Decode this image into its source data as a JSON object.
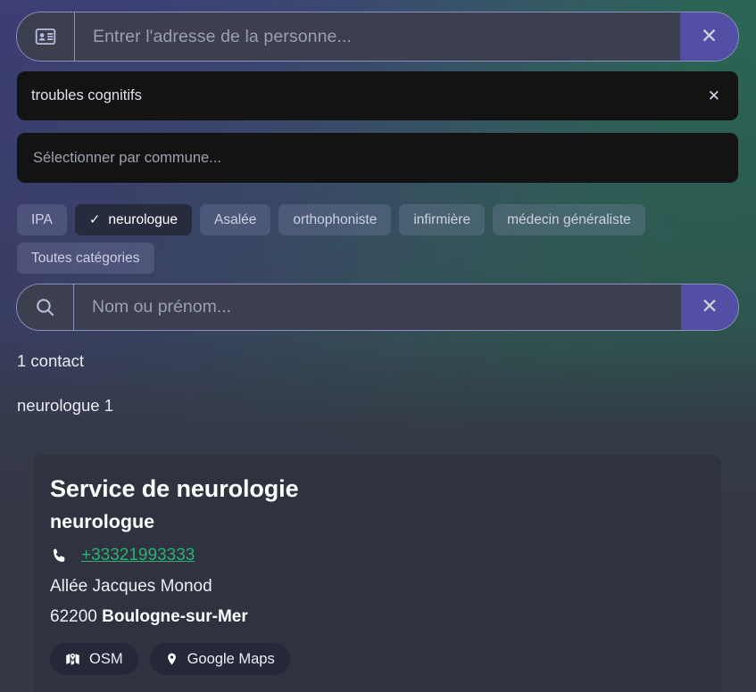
{
  "address_search": {
    "icon": "contact-card-icon",
    "placeholder": "Entrer l'adresse de la personne...",
    "value": "",
    "clear_label": "✕"
  },
  "tag_field": {
    "value": "troubles cognitifs",
    "clear_label": "✕"
  },
  "commune_select": {
    "placeholder": "Sélectionner par commune...",
    "value": ""
  },
  "category_chips": [
    {
      "label": "IPA",
      "selected": false
    },
    {
      "label": "neurologue",
      "selected": true,
      "check": "✓"
    },
    {
      "label": "Asalée",
      "selected": false
    },
    {
      "label": "orthophoniste",
      "selected": false
    },
    {
      "label": "infirmière",
      "selected": false
    },
    {
      "label": "médecin généraliste",
      "selected": false
    },
    {
      "label": "Toutes catégories",
      "selected": false
    }
  ],
  "name_search": {
    "icon": "search-icon",
    "placeholder": "Nom ou prénom...",
    "value": "",
    "clear_label": "✕"
  },
  "results": {
    "contact_count_text": "1 contact",
    "category_count_text": "neurologue 1"
  },
  "card": {
    "title": "Service de neurologie",
    "subtitle": "neurologue",
    "phone": "+33321993333",
    "street": "Allée Jacques Monod",
    "postal_code": "62200",
    "city": "Boulogne-sur-Mer",
    "map_buttons": [
      {
        "label": "OSM",
        "icon": "map-icon"
      },
      {
        "label": "Google Maps",
        "icon": "map-pin-icon"
      }
    ]
  },
  "colors": {
    "accent_purple": "#524fa5",
    "phone_green": "#2fae74",
    "card_bg": "#2f333f",
    "field_dark": "#131313",
    "page_bg": "#343845"
  }
}
